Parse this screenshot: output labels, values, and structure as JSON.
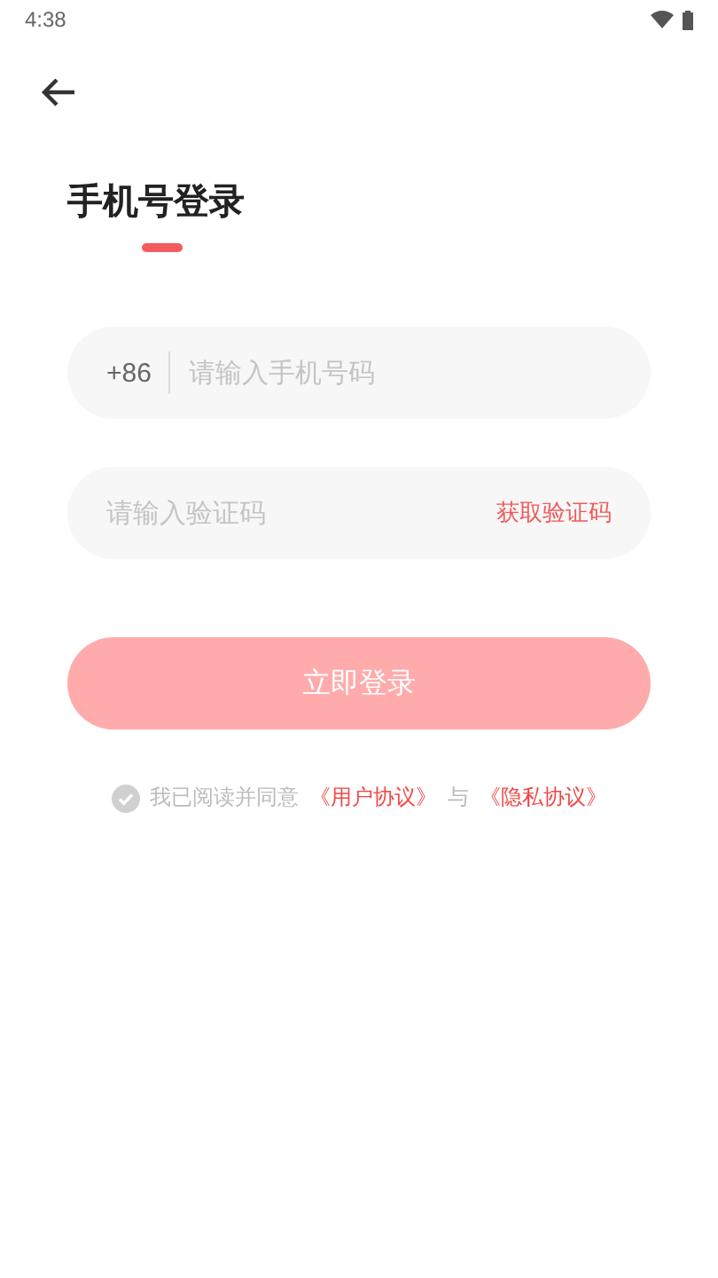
{
  "status_bar": {
    "time": "4:38"
  },
  "title": "手机号登录",
  "phone_field": {
    "country_code": "+86",
    "placeholder": "请输入手机号码"
  },
  "code_field": {
    "placeholder": "请输入验证码",
    "action": "获取验证码"
  },
  "login_button": {
    "label": "立即登录",
    "disabled": true
  },
  "agreement": {
    "checked": false,
    "text": "我已阅读并同意",
    "link_1": "《用户协议》",
    "joiner": "与",
    "link_2": "《隐私协议》"
  }
}
